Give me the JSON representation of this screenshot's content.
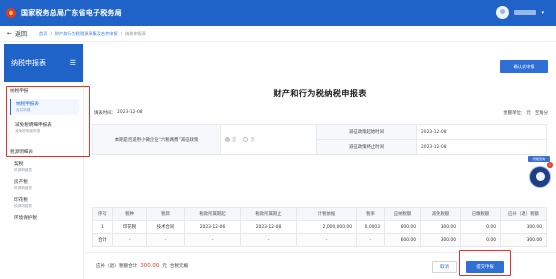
{
  "app": {
    "title": "国家税务总局广东省电子税务局",
    "user": {
      "caret": "▾"
    }
  },
  "nav": {
    "back_label": "返回",
    "breadcrumb": [
      "首页",
      "财产和行为税税源采集及合并申报",
      "纳税申报表"
    ],
    "separator": "/"
  },
  "sidebar": {
    "header": "纳税申报表",
    "group_label": "纳税申报",
    "items": [
      {
        "label": "纳税申报表",
        "sub": "合并申报"
      },
      {
        "label": "减免税明细申报表",
        "sub": "减免税明细申报"
      }
    ],
    "group2_label": "税源明细表",
    "tax_items": [
      {
        "label": "契税",
        "sub": "税源明细表"
      },
      {
        "label": "房产税",
        "sub": "税源明细表"
      },
      {
        "label": "印花税",
        "sub": "税源明细表"
      },
      {
        "label": "环境保护税",
        "sub": ""
      }
    ]
  },
  "main": {
    "confirm_label": "确认式申报",
    "form_title": "财产和行为税纳税申报表",
    "fill_date_label": "填表时间:",
    "fill_date": "2023-12-08",
    "unit_label": "金额单位:",
    "unit_value": "元",
    "unit_extra": "至角分",
    "policy_label": "本期是否适用小微企业“六税两费”减征政策",
    "policy_options": [
      "是",
      "否"
    ],
    "policy_selected": "是",
    "policy_start_label": "减征政策起始时间",
    "policy_start": "2023-12-08",
    "policy_end_label": "减征政策终止时间",
    "policy_end": "2023-12-08"
  },
  "table": {
    "headers": [
      "序号",
      "税种",
      "税目",
      "税款所属期起",
      "税款所属期止",
      "计税依据",
      "税率",
      "应纳税额",
      "减免税额",
      "已缴税额",
      "应补（退）税额"
    ],
    "rows": [
      [
        "1",
        "印花税",
        "技术合同",
        "2023-12-06",
        "2023-12-08",
        "2,000,000.00",
        "0.0003",
        "600.00",
        "300.00",
        "0.00",
        "300.00"
      ],
      [
        "合计",
        "-",
        "-",
        "-",
        "-",
        "-",
        "-",
        "600.00",
        "300.00",
        "0.00",
        "300.00"
      ]
    ]
  },
  "footer": {
    "due_label": "应补（退）税额合计",
    "due_amount": "300.00",
    "due_unit": "元",
    "explain_label": "合税元概",
    "cancel_label": "取消",
    "submit_label": "提交申报"
  },
  "assistant": {
    "tag": "智能咨询",
    "badge": "1"
  },
  "colors": {
    "brand": "#1f63c9",
    "accent": "#2f6fd6",
    "highlight": "#e8352b",
    "amount": "#e03a2b"
  }
}
